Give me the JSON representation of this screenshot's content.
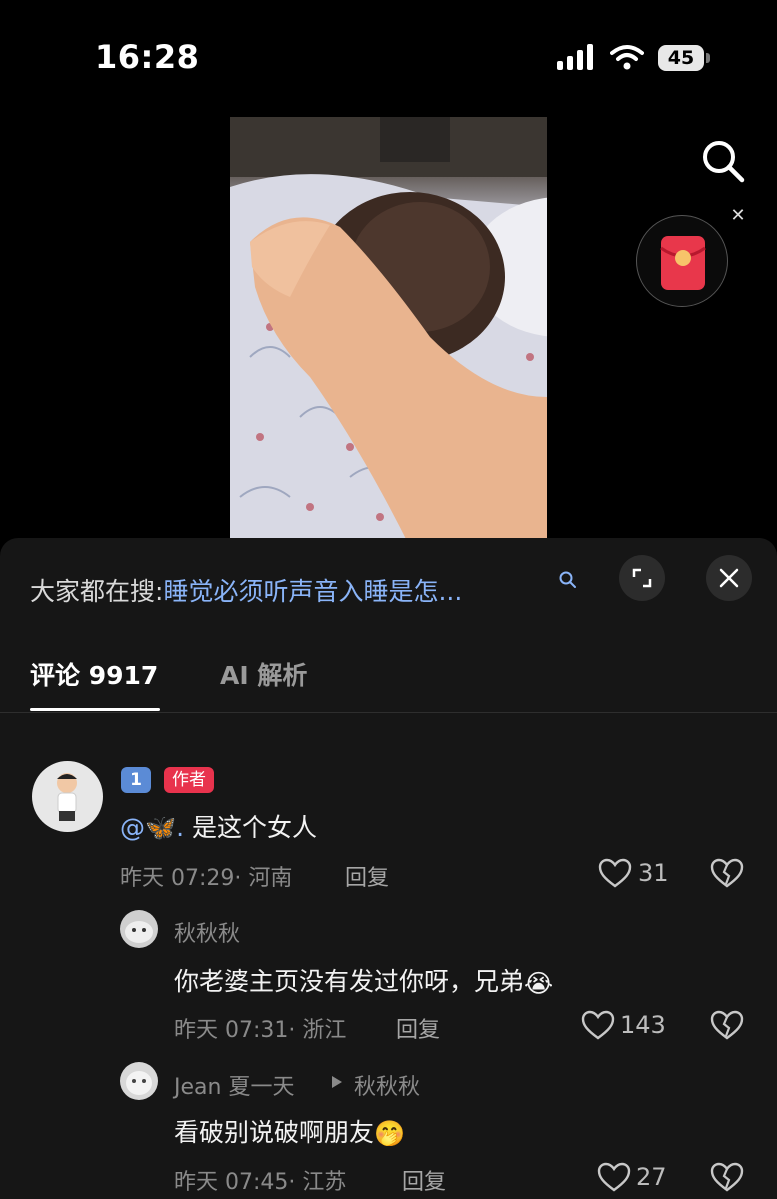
{
  "status_bar": {
    "time": "16:28",
    "battery": "45"
  },
  "panel": {
    "hot_search_prefix": "大家都在搜:",
    "hot_search_query": "睡觉必须听声音入睡是怎...",
    "tabs": {
      "comments": "评论 9917",
      "ai": "AI 解析"
    }
  },
  "comments": [
    {
      "badge_level": "1",
      "badge_author": "作者",
      "mention": "@🦋.",
      "text": " 是这个女人",
      "meta": "昨天 07:29· 河南",
      "reply": "回复",
      "likes": "31"
    },
    {
      "name": "秋秋秋",
      "text": "你老婆主页没有发过你呀，兄弟",
      "emoji": "😭",
      "meta": "昨天 07:31· 浙江",
      "reply": "回复",
      "likes": "143"
    },
    {
      "name": "Jean 夏一天",
      "reply_to": "秋秋秋",
      "text": "看破别说破啊朋友",
      "emoji": "🤭",
      "meta": "昨天 07:45· 江苏",
      "reply": "回复",
      "likes": "27"
    }
  ]
}
